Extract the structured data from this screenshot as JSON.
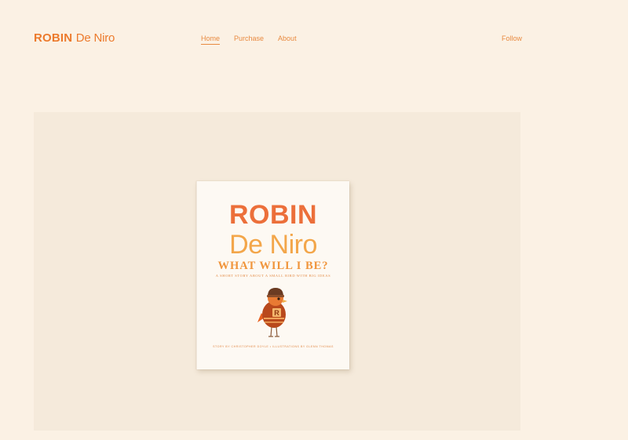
{
  "header": {
    "logo_bold": "ROBIN",
    "logo_light": "De Niro",
    "nav": [
      {
        "label": "Home",
        "active": true
      },
      {
        "label": "Purchase",
        "active": false
      },
      {
        "label": "About",
        "active": false
      }
    ],
    "follow_label": "Follow"
  },
  "hero": {
    "book": {
      "title_line1": "ROBIN",
      "title_line2": "De Niro",
      "subtitle": "WHAT WILL I BE?",
      "tagline": "A SHORT STORY ABOUT A SMALL BIRD WITH BIG IDEAS",
      "credits": "STORY BY CHRISTOPHER DOYLE • ILLUSTRATIONS BY GLENN THOMAS",
      "illustration": "robin-bird-illustration"
    }
  },
  "colors": {
    "background": "#fbf1e4",
    "hero_background": "#f5eadb",
    "accent": "#ec7a2c",
    "book_cover": "#fdf9f3"
  }
}
